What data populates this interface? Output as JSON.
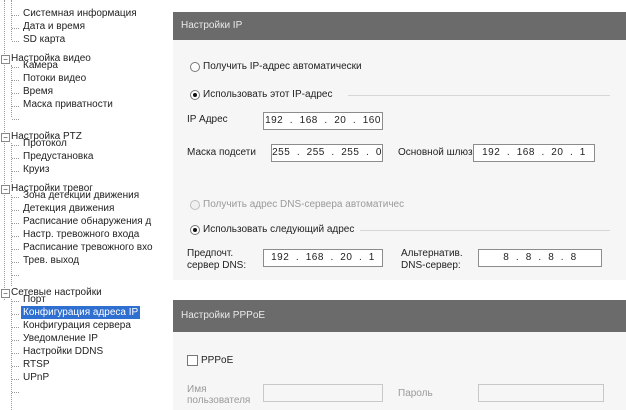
{
  "tree": {
    "items": [
      {
        "id": "sysinfo",
        "label": "Системная информация"
      },
      {
        "id": "datetime",
        "label": "Дата и время"
      },
      {
        "id": "sdcard",
        "label": "SD карта"
      },
      {
        "id": "video",
        "label": "Настройка видео"
      },
      {
        "id": "camera",
        "label": "Камера"
      },
      {
        "id": "streams",
        "label": "Потоки видео"
      },
      {
        "id": "time",
        "label": "Время"
      },
      {
        "id": "privacy",
        "label": "Маска приватности"
      },
      {
        "id": "ptz",
        "label": "Настройка PTZ"
      },
      {
        "id": "protocol",
        "label": "Протокол"
      },
      {
        "id": "preset",
        "label": "Предустановка"
      },
      {
        "id": "cruise",
        "label": "Круиз"
      },
      {
        "id": "alarms",
        "label": "Настройки тревог"
      },
      {
        "id": "motion_zone",
        "label": "Зона детекции движения"
      },
      {
        "id": "motion_detect",
        "label": "Детекция движения"
      },
      {
        "id": "detect_schedule",
        "label": "Расписание обнаружения д"
      },
      {
        "id": "alarm_input",
        "label": "Настр. тревожного входа"
      },
      {
        "id": "alarm_schedule",
        "label": "Расписание тревожного вхо"
      },
      {
        "id": "alarm_output",
        "label": "Трев. выход"
      },
      {
        "id": "network",
        "label": "Сетевые настройки"
      },
      {
        "id": "port",
        "label": "Порт"
      },
      {
        "id": "ip_config",
        "label": "Конфигурация адреса IP"
      },
      {
        "id": "server_config",
        "label": "Конфигурация сервера"
      },
      {
        "id": "ip_notify",
        "label": "Уведомление IP"
      },
      {
        "id": "ddns",
        "label": "Настройки DDNS"
      },
      {
        "id": "rtsp",
        "label": "RTSP"
      },
      {
        "id": "upnp",
        "label": "UPnP"
      }
    ]
  },
  "ip_section": {
    "title": "Настройки IP",
    "auto_ip_label": "Получить IP-адрес автоматически",
    "manual_ip_label": "Использовать этот IP-адрес",
    "ip_label": "IP Адрес",
    "ip_value": "192  .  168  .  20  .  160",
    "mask_label": "Маска подсети",
    "mask_value": "255  .  255  .  255  .  0",
    "gateway_label": "Основной шлюз",
    "gateway_value": "192  .  168  .  20  .  1",
    "dns_auto_label": "Получить адрес DNS-сервера автоматичес",
    "dns_manual_label": "Использовать следующий адрес",
    "preferred_dns_label_1": "Предпочт.",
    "preferred_dns_label_2": "сервер DNS:",
    "preferred_dns_value": "192  .  168  .  20  .  1",
    "alt_dns_label_1": "Альтернатив.",
    "alt_dns_label_2": "DNS-сервер:",
    "alt_dns_value": "8  .  8  .  8  .  8"
  },
  "pppoe_section": {
    "title": "Настройки PPPoE",
    "checkbox_label": "PPPoE",
    "username_label_1": "Имя",
    "username_label_2": "пользователя",
    "password_label": "Пароль"
  },
  "colors": {
    "header": "#6b6b6b",
    "selected": "#2f6fcf",
    "panel": "#f6f6f6"
  }
}
